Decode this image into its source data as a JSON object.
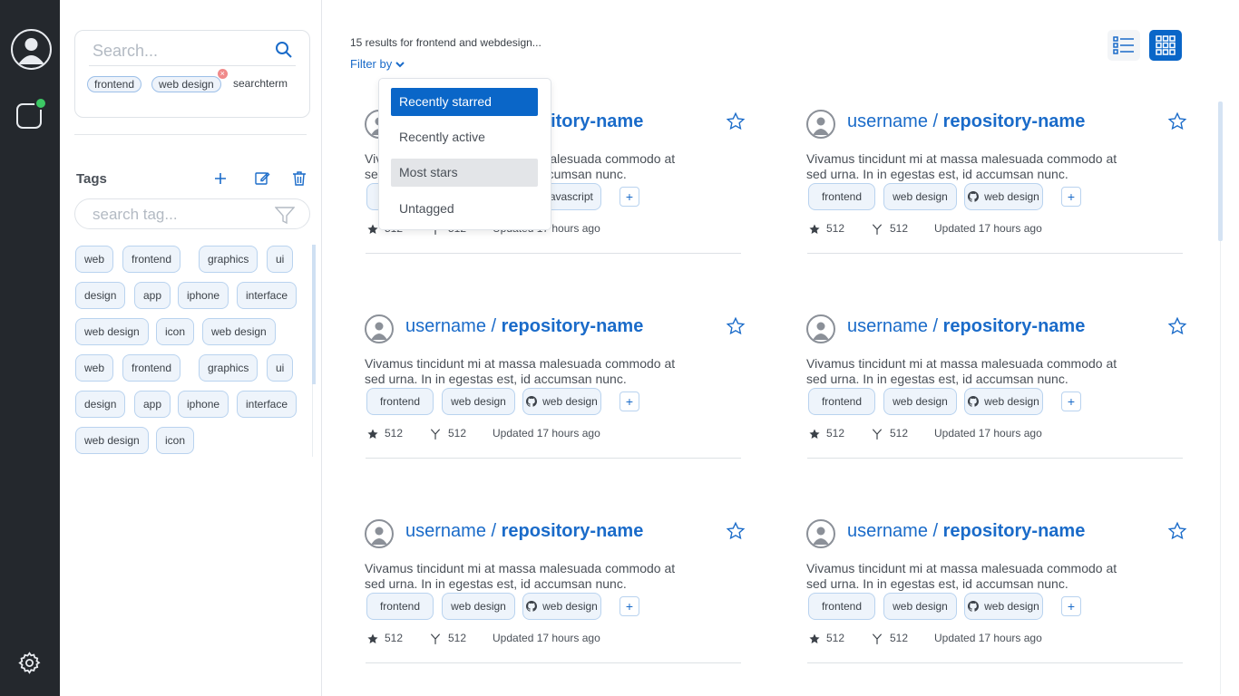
{
  "search": {
    "placeholder": "Search...",
    "tags": [
      "frontend",
      "web design"
    ],
    "term": "searchterm"
  },
  "tags_panel": {
    "title": "Tags",
    "search_placeholder": "search tag...",
    "tags": [
      "web",
      "frontend",
      "graphics",
      "ui",
      "design",
      "app",
      "iphone",
      "interface",
      "web design",
      "icon",
      "web design",
      "web",
      "frontend",
      "graphics",
      "ui",
      "design",
      "app",
      "iphone",
      "interface",
      "web design",
      "icon"
    ]
  },
  "main": {
    "results_text": "15 results for frontend and webdesign...",
    "filter_label": "Filter by"
  },
  "filter_menu": {
    "items": [
      "Recently starred",
      "Recently active",
      "Most stars",
      "Untagged"
    ],
    "selected": "Recently starred",
    "highlighted": "Most stars"
  },
  "cards": [
    {
      "owner": "username",
      "sep": "/",
      "repo": "repository-name",
      "description": "Vivamus tincidunt mi at massa malesuada commodo at sed urna. In in egestas est, id accumsan nunc.",
      "tags": [
        "frontend",
        "web design",
        "javascript"
      ],
      "stars": "512",
      "forks": "512",
      "updated": "Updated 17 hours ago"
    },
    {
      "owner": "username",
      "sep": "/",
      "repo": "repository-name",
      "description": "Vivamus tincidunt mi at massa malesuada commodo at sed urna. In in egestas est, id accumsan nunc.",
      "tags": [
        "frontend",
        "web design",
        "web design"
      ],
      "stars": "512",
      "forks": "512",
      "updated": "Updated 17 hours ago"
    },
    {
      "owner": "username",
      "sep": "/",
      "repo": "repository-name",
      "description": "Vivamus tincidunt mi at massa malesuada commodo at sed urna. In in egestas est, id accumsan nunc.",
      "tags": [
        "frontend",
        "web design",
        "web design"
      ],
      "stars": "512",
      "forks": "512",
      "updated": "Updated 17 hours ago"
    },
    {
      "owner": "username",
      "sep": "/",
      "repo": "repository-name",
      "description": "Vivamus tincidunt mi at massa malesuada commodo at sed urna. In in egestas est, id accumsan nunc.",
      "tags": [
        "frontend",
        "web design",
        "web design"
      ],
      "stars": "512",
      "forks": "512",
      "updated": "Updated 17 hours ago"
    },
    {
      "owner": "username",
      "sep": "/",
      "repo": "repository-name",
      "description": "Vivamus tincidunt mi at massa malesuada commodo at sed urna. In in egestas est, id accumsan nunc.",
      "tags": [
        "frontend",
        "web design",
        "web design"
      ],
      "stars": "512",
      "forks": "512",
      "updated": "Updated 17 hours ago"
    },
    {
      "owner": "username",
      "sep": "/",
      "repo": "repository-name",
      "description": "Vivamus tincidunt mi at massa malesuada commodo at sed urna. In in egestas est, id accumsan nunc.",
      "tags": [
        "frontend",
        "web design",
        "web design"
      ],
      "stars": "512",
      "forks": "512",
      "updated": "Updated 17 hours ago"
    }
  ],
  "colors": {
    "accent": "#0a66c8",
    "link": "#1a6bc9",
    "rail": "#24282d",
    "online": "#3cc864",
    "tag_bg": "#eef4fb",
    "tag_border": "#b9d3ef"
  }
}
